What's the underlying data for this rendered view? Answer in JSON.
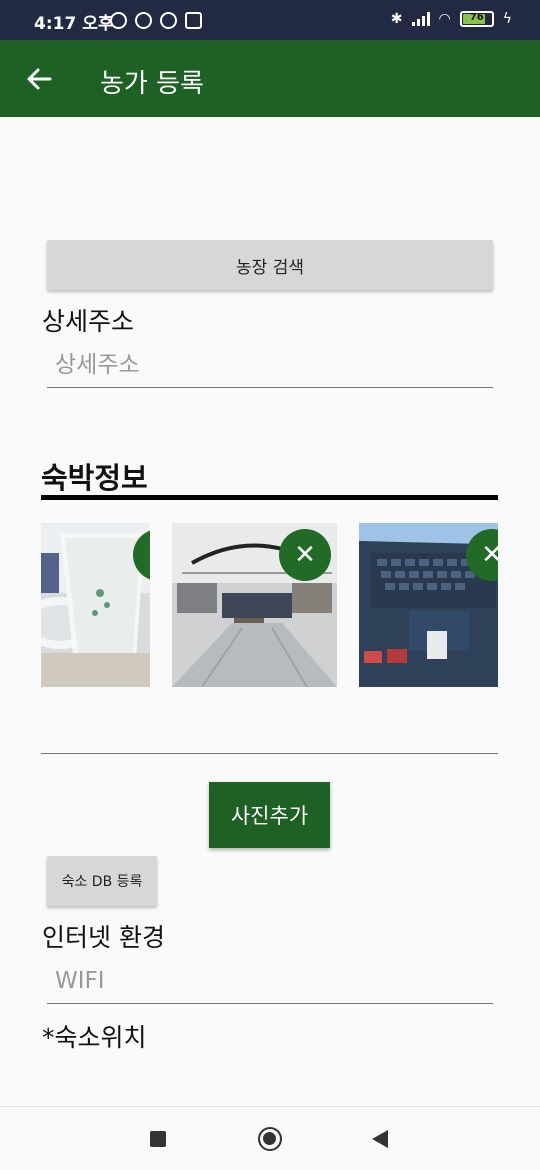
{
  "status_bar": {
    "time": "4:17 오후",
    "battery": "76"
  },
  "app_bar": {
    "title": "농가 등록"
  },
  "farm_search": {
    "label": "농장 검색"
  },
  "address": {
    "label": "상세주소",
    "placeholder": "상세주소",
    "value": ""
  },
  "lodging": {
    "section_title": "숙박정보"
  },
  "photos": [
    {
      "name": "glass-photo"
    },
    {
      "name": "mall-photo"
    },
    {
      "name": "laptop-photo"
    }
  ],
  "actions": {
    "add_photo": "사진추가",
    "register_db": "숙소 DB 등록"
  },
  "internet": {
    "label": "인터넷 환경",
    "placeholder": "WIFI",
    "value": ""
  },
  "location": {
    "label": "*숙소위치"
  },
  "icons": {
    "back": "arrow-left-icon",
    "remove": "close-icon",
    "nav_recent": "square-icon",
    "nav_home": "circle-icon",
    "nav_back": "triangle-back-icon"
  },
  "colors": {
    "primary": "#1e6125",
    "status_bar": "#222942",
    "button_gray": "#d6d7d7"
  }
}
